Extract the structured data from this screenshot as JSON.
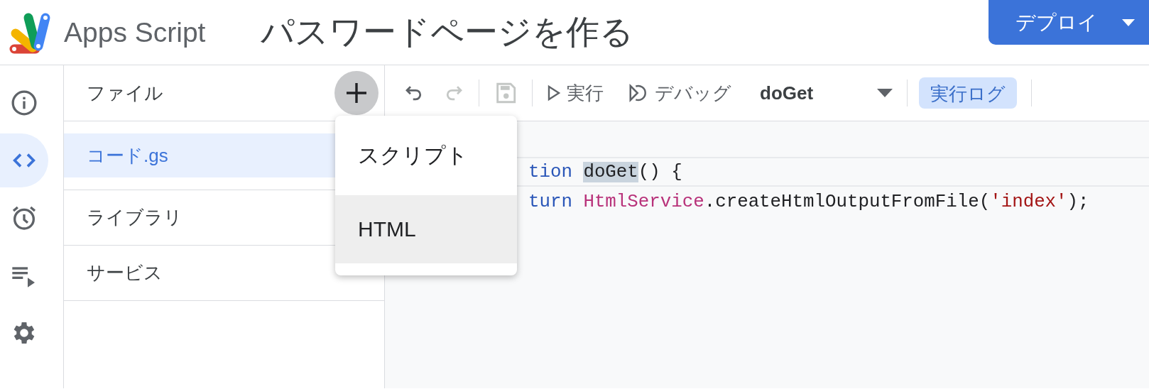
{
  "header": {
    "product": "Apps Script",
    "project_title": "パスワードページを作る",
    "deploy_button": "デプロイ"
  },
  "rail": [
    {
      "kind": "info",
      "selected": false
    },
    {
      "kind": "code",
      "selected": true
    },
    {
      "kind": "clock",
      "selected": false
    },
    {
      "kind": "executions",
      "selected": false
    },
    {
      "kind": "settings",
      "selected": false
    }
  ],
  "file_panel": {
    "title": "ファイル",
    "files": [
      {
        "name": "コード.gs",
        "selected": true
      }
    ],
    "sections": [
      "ライブラリ",
      "サービス"
    ]
  },
  "toolbar": {
    "undo_enabled": true,
    "redo_enabled": false,
    "save_enabled": false,
    "run": "実行",
    "debug": "デバッグ",
    "function": "doGet",
    "log": "実行ログ",
    "log_selected": true
  },
  "code_lines": [
    {
      "current": true,
      "tokens": [
        {
          "kind": "keyword",
          "text": "tion "
        },
        {
          "kind": "match",
          "text": "doGet"
        },
        {
          "kind": "plain",
          "text": "() {"
        }
      ]
    },
    {
      "current": false,
      "tokens": [
        {
          "kind": "keyword",
          "text": "turn "
        },
        {
          "kind": "class",
          "text": "HtmlService"
        },
        {
          "kind": "plain",
          "text": ".createHtmlOutputFromFile("
        },
        {
          "kind": "string",
          "text": "'index'"
        },
        {
          "kind": "plain",
          "text": ");"
        }
      ]
    }
  ],
  "add_menu": {
    "items": [
      {
        "label": "スクリプト",
        "selected": false
      },
      {
        "label": "HTML",
        "selected": true
      }
    ]
  }
}
